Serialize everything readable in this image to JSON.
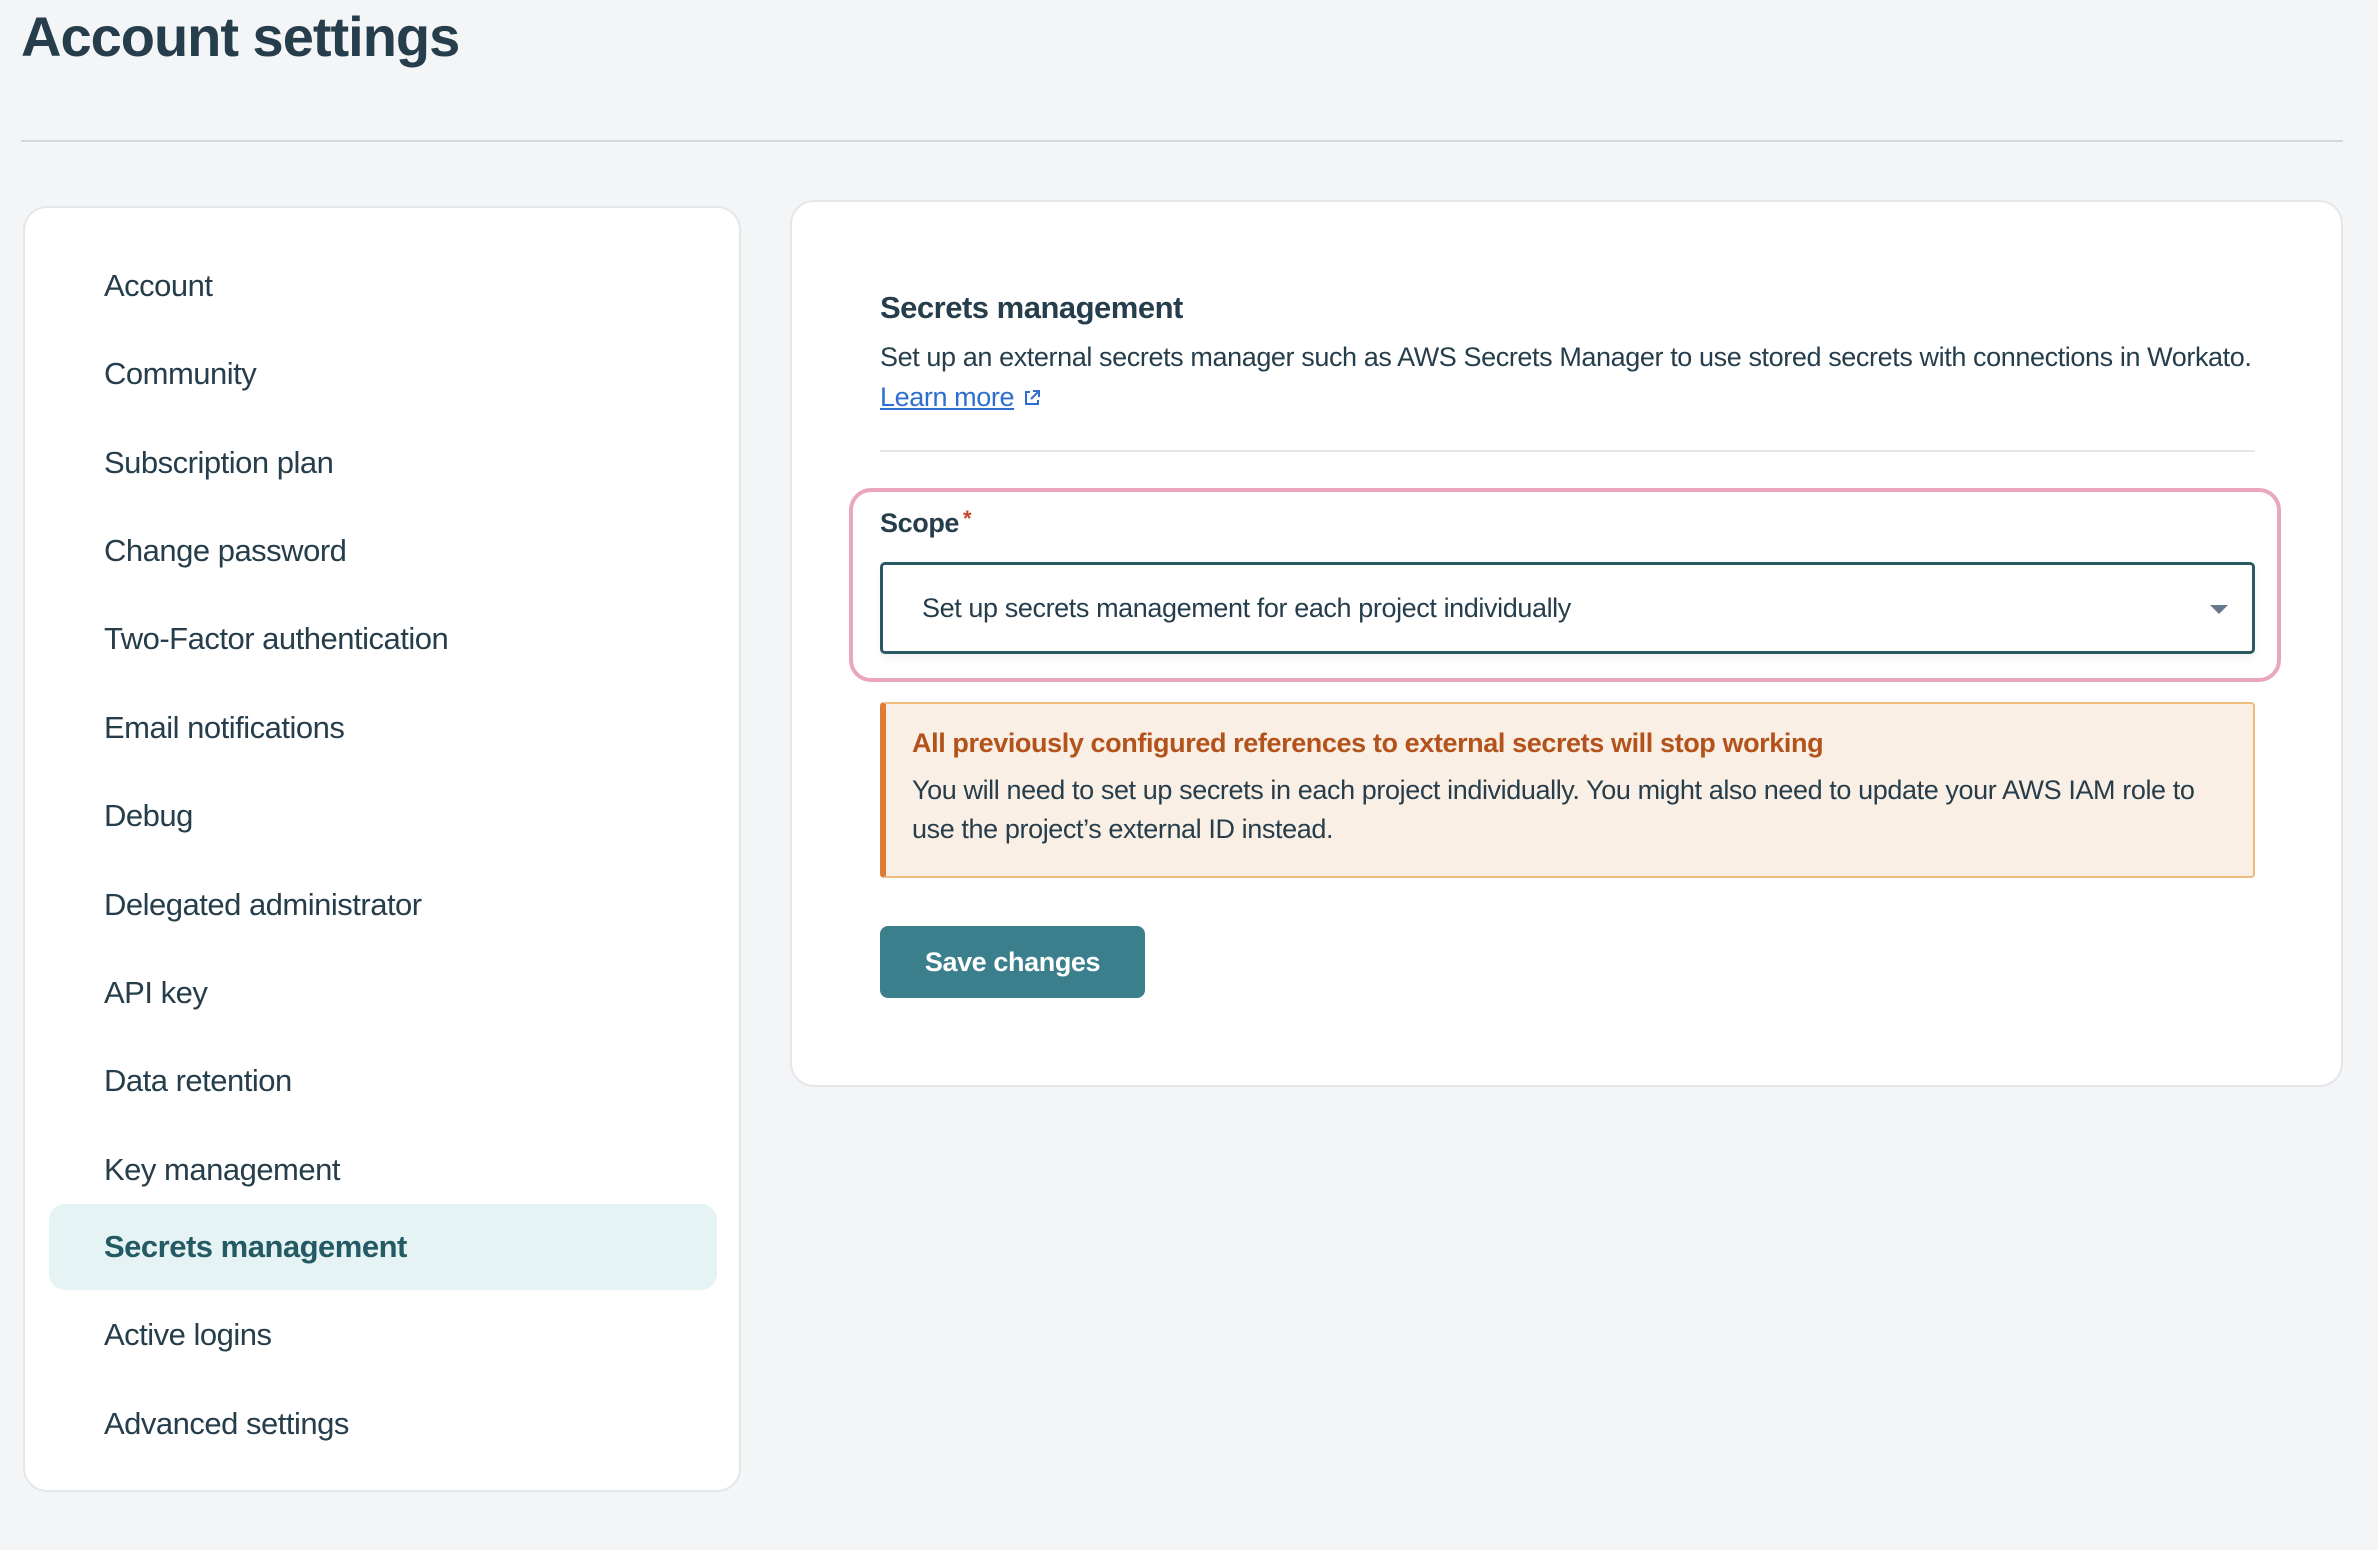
{
  "page": {
    "title": "Account settings"
  },
  "sidebar": {
    "active_index": 11,
    "items": [
      {
        "label": "Account"
      },
      {
        "label": "Community"
      },
      {
        "label": "Subscription plan"
      },
      {
        "label": "Change password"
      },
      {
        "label": "Two-Factor authentication"
      },
      {
        "label": "Email notifications"
      },
      {
        "label": "Debug"
      },
      {
        "label": "Delegated administrator"
      },
      {
        "label": "API key"
      },
      {
        "label": "Data retention"
      },
      {
        "label": "Key management"
      },
      {
        "label": "Secrets management"
      },
      {
        "label": "Active logins"
      },
      {
        "label": "Advanced settings"
      }
    ]
  },
  "main": {
    "section_title": "Secrets management",
    "description": "Set up an external secrets manager such as AWS Secrets Manager to use stored secrets with connections in Workato.",
    "learn_more": "Learn more",
    "learn_more_icon": "external-link-icon",
    "scope": {
      "label": "Scope",
      "required_marker": "*",
      "selected_value": "Set up secrets management for each project individually",
      "dropdown_icon": "caret-down-icon"
    },
    "warning": {
      "title": "All previously configured references to external secrets will stop working",
      "body": "You will need to set up secrets in each project individually. You might also need to update your AWS IAM role to use the project’s external ID instead."
    },
    "save_label": "Save changes"
  },
  "colors": {
    "accent": "#3c7f8c",
    "active_item_bg": "#e5f3f4",
    "warning_bg": "#f9efe5",
    "warning_border": "#de7c37",
    "warning_title": "#b4521b",
    "highlight_outline": "#e9a6bd",
    "link": "#2d6fd0"
  }
}
